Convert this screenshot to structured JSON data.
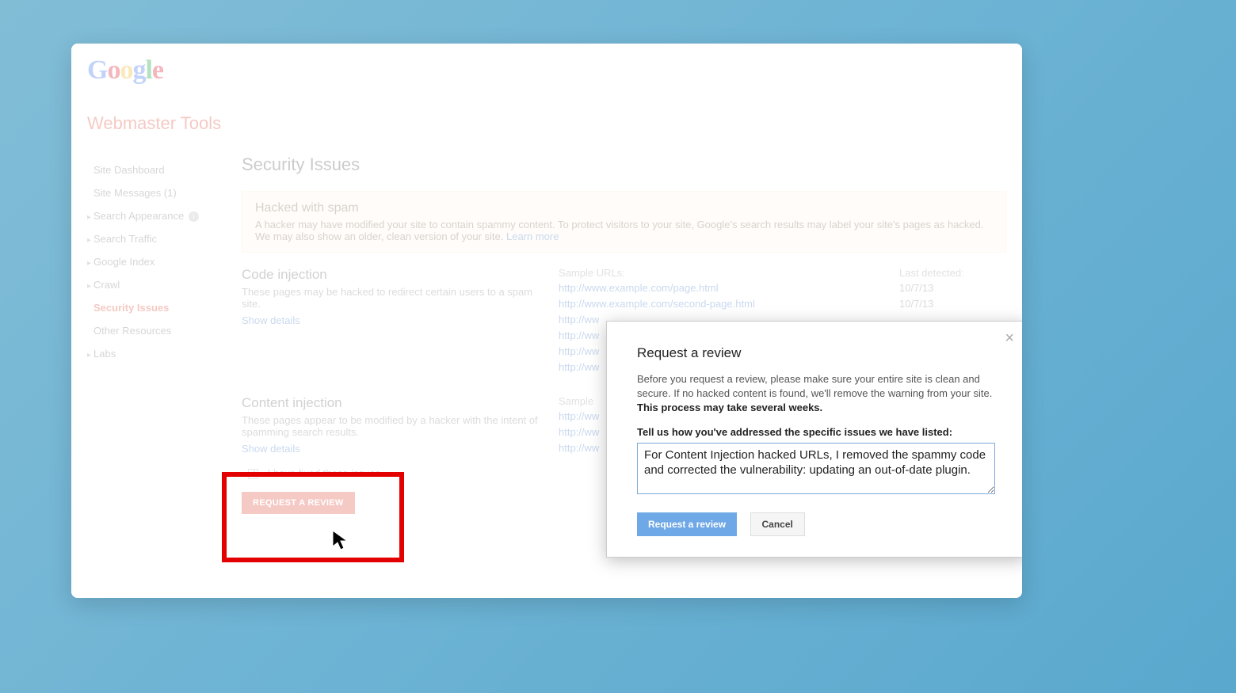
{
  "header": {
    "logo_text": "Google",
    "product_title": "Webmaster Tools"
  },
  "sidebar": {
    "items": [
      {
        "label": "Site Dashboard",
        "expandable": false
      },
      {
        "label": "Site Messages (1)",
        "expandable": false
      },
      {
        "label": "Search Appearance",
        "expandable": true,
        "info": true
      },
      {
        "label": "Search Traffic",
        "expandable": true
      },
      {
        "label": "Google Index",
        "expandable": true
      },
      {
        "label": "Crawl",
        "expandable": true
      },
      {
        "label": "Security Issues",
        "expandable": false,
        "active": true
      },
      {
        "label": "Other Resources",
        "expandable": false
      },
      {
        "label": "Labs",
        "expandable": true
      }
    ]
  },
  "main": {
    "page_title": "Security Issues",
    "alert": {
      "title": "Hacked with spam",
      "body": "A hacker may have modified your site to contain spammy content. To protect visitors to your site, Google's search results may label your site's pages as hacked. We may also show an older, clean version of your site.",
      "learn_more": "Learn more"
    },
    "columns": {
      "sample_urls": "Sample URLs:",
      "last_detected": "Last detected:"
    },
    "issues": [
      {
        "title": "Code injection",
        "desc": "These pages may be hacked to redirect certain users to a spam site.",
        "show_details": "Show details",
        "urls": [
          "http://www.example.com/page.html",
          "http://www.example.com/second-page.html",
          "http://ww",
          "http://ww",
          "http://ww",
          "http://ww"
        ],
        "dates": [
          "10/7/13",
          "10/7/13"
        ]
      },
      {
        "title": "Content injection",
        "desc": "These pages appear to be modified by a hacker with the intent of spamming search results.",
        "show_details": "Show details",
        "urls": [
          "http://ww",
          "http://ww",
          "http://ww"
        ],
        "dates": []
      }
    ],
    "fix": {
      "checkbox_label": "I have fixed these issues",
      "button_label": "REQUEST A REVIEW"
    }
  },
  "modal": {
    "title": "Request a review",
    "intro_a": "Before you request a review, please make sure your entire site is clean and secure. If no hacked content is found, we'll remove the warning from your site. ",
    "intro_bold": "This process may take several weeks.",
    "field_label": "Tell us how you've addressed the specific issues we have listed:",
    "textarea_value": "For Content Injection hacked URLs, I removed the spammy code and corrected the vulnerability: updating an out-of-date plugin.",
    "primary": "Request a review",
    "secondary": "Cancel"
  }
}
